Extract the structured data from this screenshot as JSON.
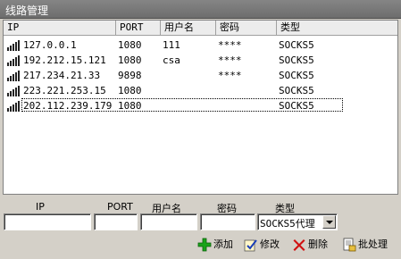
{
  "window": {
    "title": "线路管理"
  },
  "list": {
    "columns": [
      "IP",
      "PORT",
      "用户名",
      "密码",
      "类型"
    ],
    "rows": [
      {
        "ip": "127.0.0.1",
        "port": "1080",
        "user": "111",
        "password": "****",
        "type": "SOCKS5"
      },
      {
        "ip": "192.212.15.121",
        "port": "1080",
        "user": "csa",
        "password": "****",
        "type": "SOCKS5"
      },
      {
        "ip": "217.234.21.33",
        "port": "9898",
        "user": "",
        "password": "****",
        "type": "SOCKS5"
      },
      {
        "ip": "223.221.253.15",
        "port": "1080",
        "user": "",
        "password": "",
        "type": "SOCKS5"
      },
      {
        "ip": "202.112.239.179",
        "port": "1080",
        "user": "",
        "password": "",
        "type": "SOCKS5"
      }
    ]
  },
  "form": {
    "ip_label": "IP",
    "port_label": "PORT",
    "user_label": "用户名",
    "password_label": "密码",
    "type_label": "类型",
    "ip_value": "",
    "port_value": "",
    "user_value": "",
    "password_value": "",
    "type_value": "SOCKS5代理"
  },
  "actions": {
    "add": "添加",
    "edit": "修改",
    "delete": "删除",
    "batch": "批处理"
  },
  "colors": {
    "add_icon": "#1aa31a",
    "delete_icon": "#d01010",
    "titlebar": "#7a7a7a"
  }
}
